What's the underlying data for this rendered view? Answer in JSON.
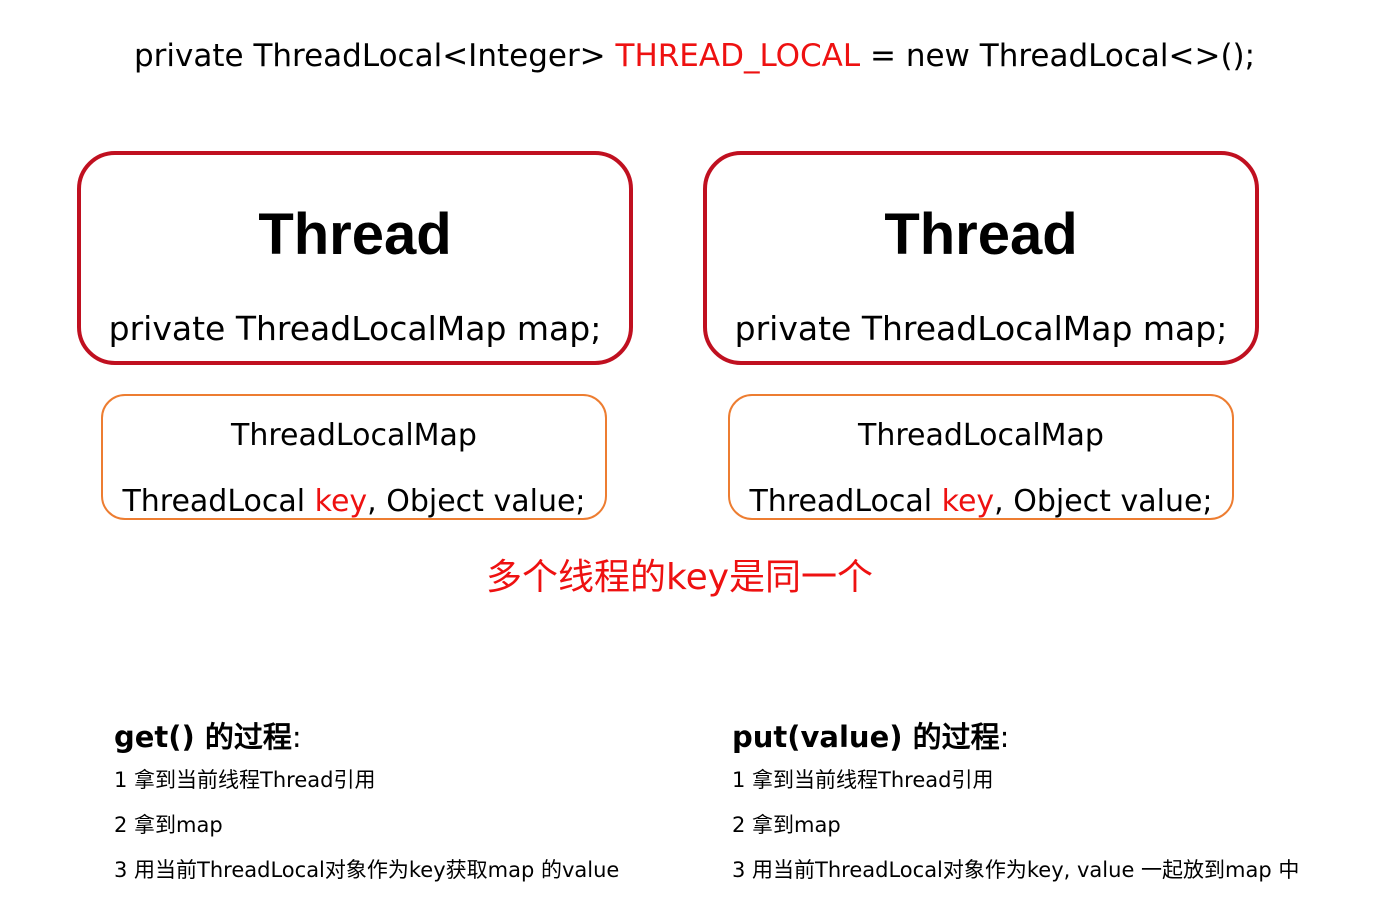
{
  "declaration": {
    "prefix": "private ThreadLocal<Integer> ",
    "name": "THREAD_LOCAL",
    "suffix": " = new ThreadLocal<>();"
  },
  "threads": [
    {
      "title": "Thread",
      "field": "private ThreadLocalMap map;",
      "map": {
        "title": "ThreadLocalMap",
        "entry_prefix": "ThreadLocal ",
        "entry_key": "key",
        "entry_suffix": ",  Object value;"
      }
    },
    {
      "title": "Thread",
      "field": "private ThreadLocalMap map;",
      "map": {
        "title": "ThreadLocalMap",
        "entry_prefix": "ThreadLocal ",
        "entry_key": "key",
        "entry_suffix": ",  Object value;"
      }
    }
  ],
  "note": "多个线程的key是同一个",
  "get_process": {
    "heading": "get() 的过程",
    "colon": ":",
    "steps": [
      "1 拿到当前线程Thread引用",
      "2 拿到map",
      "3 用当前ThreadLocal对象作为key获取map  的value"
    ]
  },
  "put_process": {
    "heading": "put(value) 的过程",
    "colon": ":",
    "steps": [
      "1 拿到当前线程Thread引用",
      "2 拿到map",
      "3 用当前ThreadLocal对象作为key, value 一起放到map 中"
    ]
  },
  "colors": {
    "highlight": "#ee1111",
    "thread_border": "#c01020",
    "map_border": "#ed7d31"
  }
}
